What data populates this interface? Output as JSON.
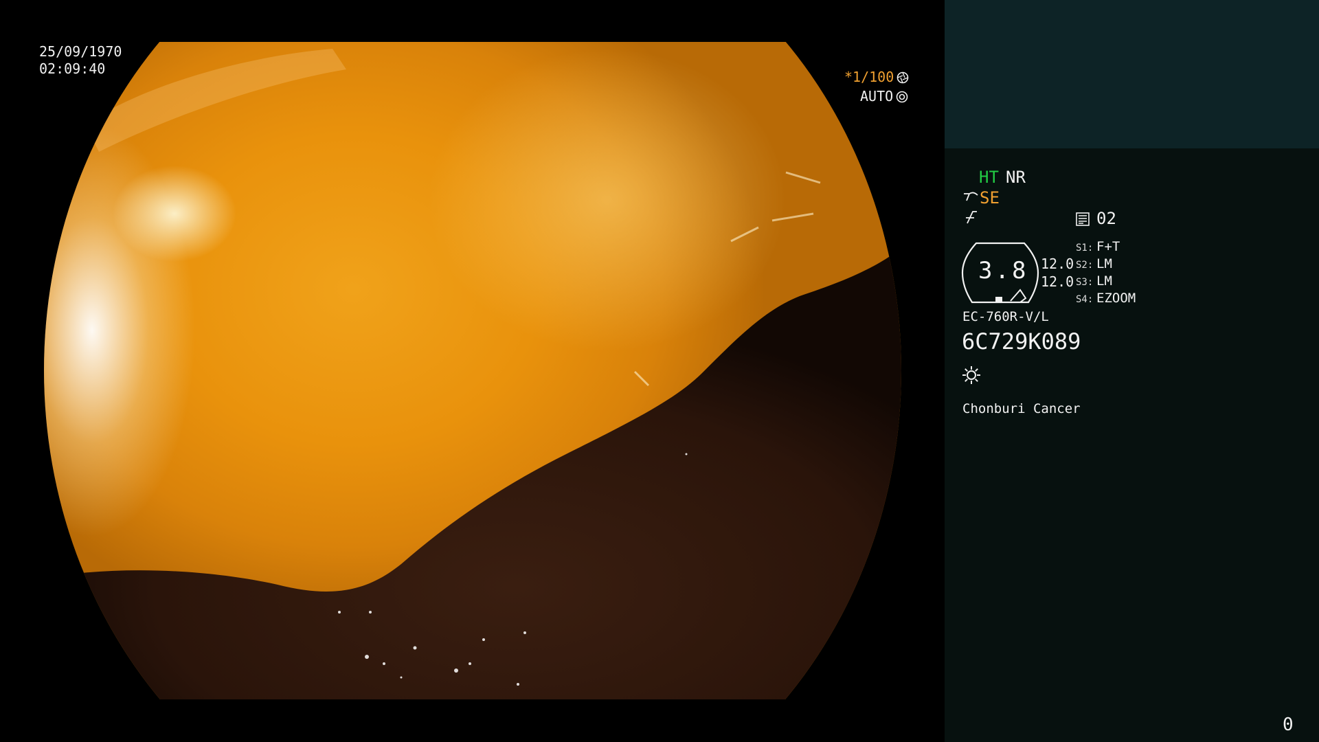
{
  "overlay": {
    "date": "25/09/1970",
    "time": "02:09:40",
    "shutter": "*1/100",
    "shutter_icon": "aperture-icon",
    "iris_mode": "AUTO",
    "iris_icon": "iris-icon"
  },
  "panel": {
    "enhancement": {
      "ht": "HT",
      "nr": "NR"
    },
    "structure_enhancement": {
      "label": "SE",
      "icon": "structure-enhancement-icon"
    },
    "freeze_icon": "freeze-icon",
    "memory": {
      "icon": "memory-icon",
      "value": "02"
    },
    "magnification": {
      "value": "3.8",
      "icon": "scope-magnification-icon"
    },
    "levels": [
      "12.0",
      "12.0"
    ],
    "switches": [
      {
        "key": "S1:",
        "value": "F+T"
      },
      {
        "key": "S2:",
        "value": "LM"
      },
      {
        "key": "S3:",
        "value": "LM"
      },
      {
        "key": "S4:",
        "value": "EZOOM"
      }
    ],
    "scope_model": "EC-760R-V/L",
    "scope_serial": "6C729K089",
    "light_icon": "light-source-icon",
    "institution": "Chonburi Cancer",
    "counter": "0"
  },
  "colors": {
    "accent_green": "#22cc44",
    "accent_orange": "#f0a030",
    "panel_top": "#0d2326",
    "panel_body": "#07110f"
  }
}
